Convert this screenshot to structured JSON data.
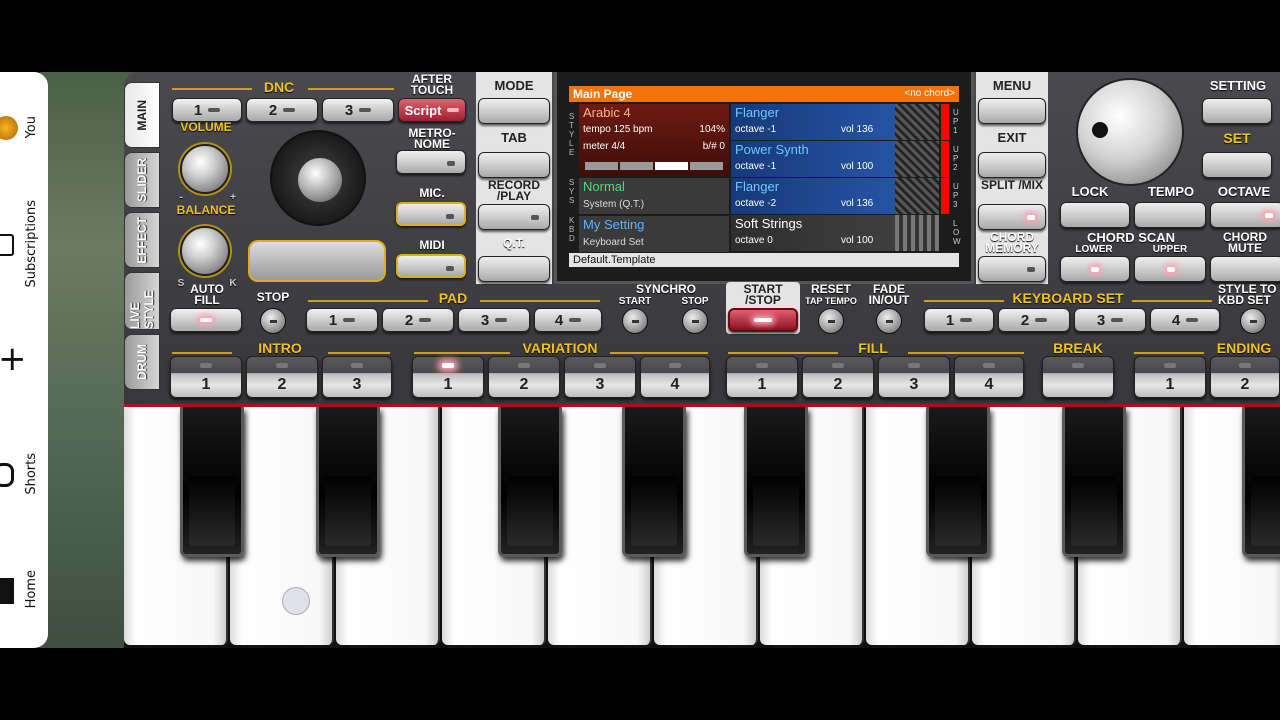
{
  "youtube": {
    "items": [
      {
        "label": "You",
        "icon": "avatar-icon"
      },
      {
        "label": "Subscriptions",
        "icon": "subscriptions-icon"
      },
      {
        "label": "",
        "icon": "plus-icon"
      },
      {
        "label": "Shorts",
        "icon": "shorts-icon"
      },
      {
        "label": "Home",
        "icon": "home-icon"
      }
    ]
  },
  "tabs": [
    "MAIN",
    "SLIDER",
    "EFFECT",
    "LIVE STYLE",
    "DRUM"
  ],
  "dnc": {
    "title": "DNC",
    "buttons": [
      "1",
      "2",
      "3"
    ]
  },
  "after_touch": {
    "label": "AFTER TOUCH",
    "value": "Script"
  },
  "volume_label": "VOLUME",
  "balance_label": "BALANCE",
  "balance_marks": {
    "minus": "-",
    "plus": "+",
    "s": "S",
    "k": "K"
  },
  "metronome_label": "METRO- NOME",
  "mic_label": "MIC.",
  "midi_label": "MIDI",
  "left_menu": [
    "MODE",
    "TAB",
    "RECORD /PLAY",
    "Q.T."
  ],
  "right_menu": [
    "MENU",
    "EXIT",
    "SPLIT /MIX",
    "CHORD MEMORY"
  ],
  "display": {
    "title": "Main Page",
    "chord": "<no chord>",
    "style": {
      "name": "Arabic 4",
      "tempo": "tempo 125 bpm",
      "percent": "104%",
      "meter": "meter 4/4",
      "transpose": "b/# 0"
    },
    "sys": {
      "name": "Normal",
      "sub": "System (Q.T.)"
    },
    "kbd": {
      "name": "My Setting",
      "sub": "Keyboard Set"
    },
    "side_left": {
      "style": "STYLE",
      "sys": "SYS",
      "kbd": "KBD"
    },
    "side_right": [
      "UP1",
      "UP2",
      "UP3",
      "LOW"
    ],
    "voices": [
      {
        "name": "Flanger",
        "octave": "octave -1",
        "vol": "vol 136"
      },
      {
        "name": "Power Synth",
        "octave": "octave -1",
        "vol": "vol 100"
      },
      {
        "name": "Flanger",
        "octave": "octave -2",
        "vol": "vol 136"
      },
      {
        "name": "Soft Strings",
        "octave": "octave  0",
        "vol": "vol 100"
      }
    ],
    "footer": "Default.Template"
  },
  "setting_label": "SETTING",
  "set_label": "SET",
  "lock_label": "LOCK",
  "tempo_label": "TEMPO",
  "octave_label": "OCTAVE",
  "chord_scan": {
    "title": "CHORD SCAN",
    "lower": "LOWER",
    "upper": "UPPER"
  },
  "chord_mute_label": "CHORD MUTE",
  "auto_fill_label": "AUTO FILL",
  "stop_label": "STOP",
  "pad": {
    "title": "PAD",
    "buttons": [
      "1",
      "2",
      "3",
      "4"
    ]
  },
  "synchro": {
    "title": "SYNCHRO",
    "start": "START",
    "stop": "STOP"
  },
  "start_stop_label": "START /STOP",
  "reset": {
    "title": "RESET",
    "sub": "TAP TEMPO"
  },
  "fade_label": "FADE IN/OUT",
  "keyboard_set": {
    "title": "KEYBOARD SET",
    "buttons": [
      "1",
      "2",
      "3",
      "4"
    ]
  },
  "style_to_kbd_label": "STYLE TO KBD SET",
  "intro": {
    "title": "INTRO",
    "buttons": [
      "1",
      "2",
      "3"
    ]
  },
  "variation": {
    "title": "VARIATION",
    "buttons": [
      "1",
      "2",
      "3",
      "4"
    ]
  },
  "fill": {
    "title": "FILL",
    "buttons": [
      "1",
      "2",
      "3",
      "4"
    ]
  },
  "break_label": "BREAK",
  "ending": {
    "title": "ENDING",
    "buttons": [
      "1",
      "2"
    ]
  }
}
